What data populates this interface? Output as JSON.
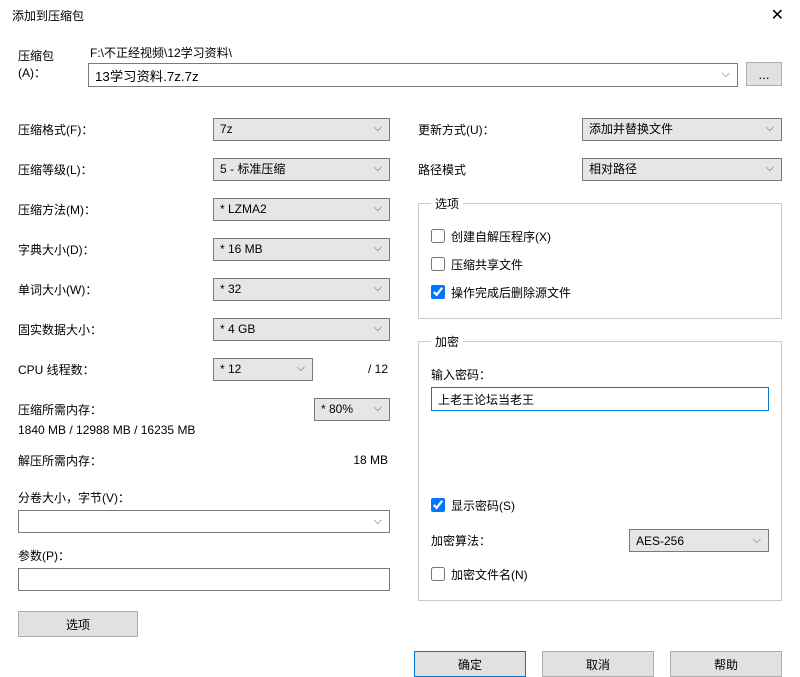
{
  "title": "添加到压缩包",
  "archive": {
    "label": "压缩包(A)：",
    "path": "F:\\不正经视频\\12学习资料\\",
    "filename": "13学习资料.7z.7z",
    "browse": "..."
  },
  "left": {
    "format_label": "压缩格式(F)：",
    "format_value": "7z",
    "level_label": "压缩等级(L)：",
    "level_value": "5 - 标准压缩",
    "method_label": "压缩方法(M)：",
    "method_value": "* LZMA2",
    "dict_label": "字典大小(D)：",
    "dict_value": "* 16 MB",
    "word_label": "单词大小(W)：",
    "word_value": "* 32",
    "solid_label": "固实数据大小：",
    "solid_value": "* 4 GB",
    "cpu_label": "CPU 线程数：",
    "cpu_value": "* 12",
    "cpu_total": "/ 12",
    "mem_compress_label": "压缩所需内存：",
    "mem_compress_value": "1840 MB / 12988 MB / 16235 MB",
    "mem_pct": "* 80%",
    "mem_decompress_label": "解压所需内存：",
    "mem_decompress_value": "18 MB",
    "volume_label": "分卷大小，字节(V)：",
    "volume_value": "",
    "params_label": "参数(P)：",
    "params_value": "",
    "options_btn": "选项"
  },
  "right": {
    "update_label": "更新方式(U)：",
    "update_value": "添加并替换文件",
    "pathmode_label": "路径模式",
    "pathmode_value": "相对路径",
    "opts_legend": "选项",
    "opt_sfx": "创建自解压程序(X)",
    "opt_share": "压缩共享文件",
    "opt_delete": "操作完成后删除源文件",
    "enc_legend": "加密",
    "enc_pw_label": "输入密码：",
    "enc_pw_value": "上老王论坛当老王",
    "enc_show": "显示密码(S)",
    "enc_alg_label": "加密算法：",
    "enc_alg_value": "AES-256",
    "enc_names": "加密文件名(N)"
  },
  "footer": {
    "ok": "确定",
    "cancel": "取消",
    "help": "帮助"
  }
}
